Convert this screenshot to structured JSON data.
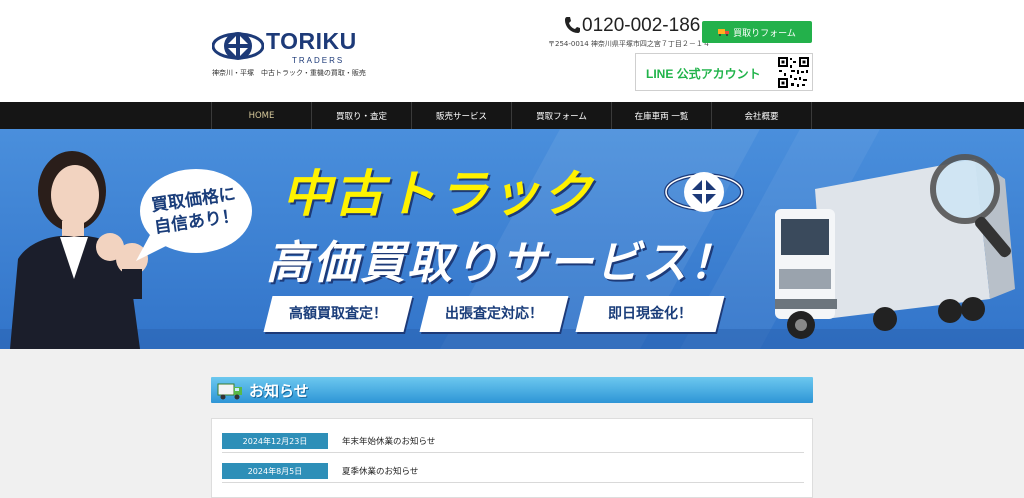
{
  "header": {
    "logo_name": "TORIKU",
    "logo_sub": "TRADERS",
    "tagline": "神奈川・平塚　中古トラック・重機の買取・販売",
    "phone": "0120-002-186",
    "address": "〒254-0014 神奈川県平塚市四之宮７丁目２－１４",
    "form_button": "買取りフォーム",
    "line_label": "LINE 公式アカウント"
  },
  "nav": {
    "items": [
      {
        "label": "HOME"
      },
      {
        "label": "買取り・査定"
      },
      {
        "label": "販売サービス"
      },
      {
        "label": "買取フォーム"
      },
      {
        "label": "在庫車両 一覧"
      },
      {
        "label": "会社概要"
      }
    ]
  },
  "hero": {
    "bubble_line1": "買取価格に",
    "bubble_line2": "自信あり！",
    "title1": "中古トラック",
    "title2": "高価買取りサービス！",
    "badges": [
      "高額買取査定！",
      "出張査定対応！",
      "即日現金化！"
    ]
  },
  "news": {
    "heading": "お知らせ",
    "items": [
      {
        "date": "2024年12月23日",
        "title": "年末年始休業のお知らせ"
      },
      {
        "date": "2024年8月5日",
        "title": "夏季休業のお知らせ"
      }
    ]
  },
  "colors": {
    "brand_navy": "#1d3a78",
    "green_button": "#23b14b",
    "line_green": "#20b34a",
    "hero_blue": "#3274c9",
    "hero_yellow": "#fff200",
    "date_badge": "#2e8fb8"
  }
}
